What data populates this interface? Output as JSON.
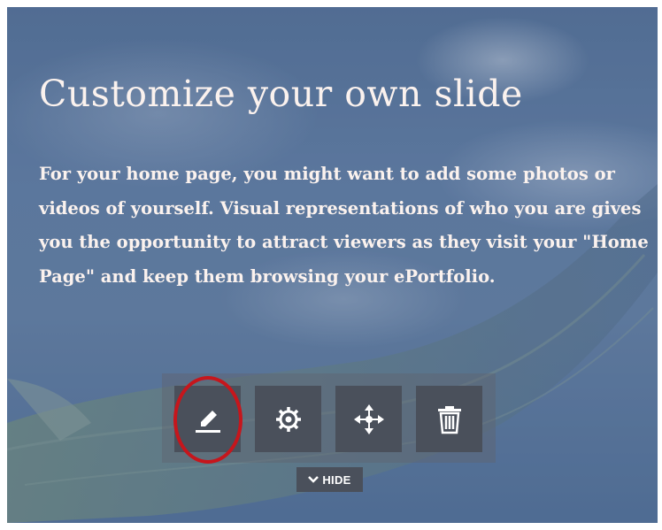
{
  "slide": {
    "title": "Customize your own slide",
    "body": "For your home page, you might want to add some photos or videos of yourself.  Visual representations of who you are gives you the opportunity to attract viewers as they visit your \"Home Page\" and keep them browsing your ePortfolio."
  },
  "toolbar": {
    "buttons": [
      {
        "icon": "pencil-icon",
        "name": "edit"
      },
      {
        "icon": "gear-icon",
        "name": "settings"
      },
      {
        "icon": "move-arrows-icon",
        "name": "move"
      },
      {
        "icon": "trash-icon",
        "name": "delete"
      }
    ],
    "hide_label": "HIDE",
    "hide_icon": "chevron-down-icon"
  },
  "colors": {
    "text": "#fbf2ee",
    "button_bg": "#4a505b",
    "highlight": "#c6161c"
  }
}
